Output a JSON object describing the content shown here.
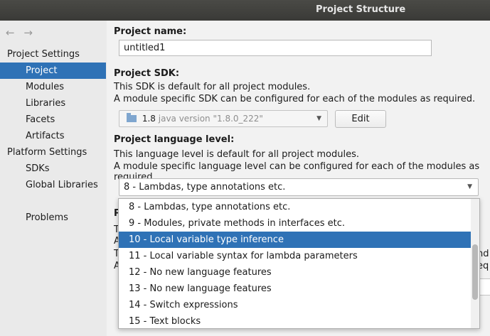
{
  "window": {
    "title": "Project Structure"
  },
  "nav": {
    "back": "←",
    "forward": "→"
  },
  "sidebar": {
    "project_settings_label": "Project Settings",
    "project_settings_items": [
      "Project",
      "Modules",
      "Libraries",
      "Facets",
      "Artifacts"
    ],
    "platform_settings_label": "Platform Settings",
    "platform_settings_items": [
      "SDKs",
      "Global Libraries"
    ],
    "problems": "Problems",
    "selected": "Project"
  },
  "project_name": {
    "label": "Project name:",
    "value": "untitled1"
  },
  "project_sdk": {
    "label": "Project SDK:",
    "desc1": "This SDK is default for all project modules.",
    "desc2": "A module specific SDK can be configured for each of the modules as required.",
    "selected_version": "1.8",
    "selected_detail": "java version \"1.8.0_222\"",
    "edit_label": "Edit"
  },
  "language_level": {
    "label": "Project language level:",
    "desc1": "This language level is default for all project modules.",
    "desc2": "A module specific language level can be configured for each of the modules as required.",
    "selected": "8 - Lambdas, type annotations etc.",
    "options": [
      "8 - Lambdas, type annotations etc.",
      "9 - Modules, private methods in interfaces etc.",
      "10 - Local variable type inference",
      "11 - Local variable syntax for lambda parameters",
      "12 - No new language features",
      "13 - No new language features",
      "14 - Switch expressions",
      "15 - Text blocks"
    ],
    "highlighted": "10 - Local variable type inference"
  },
  "obscured": {
    "p": "P",
    "t1": "T",
    "a1": "A",
    "t2": "T",
    "a2": "A",
    "nd": "nd",
    "eq": "eq"
  }
}
